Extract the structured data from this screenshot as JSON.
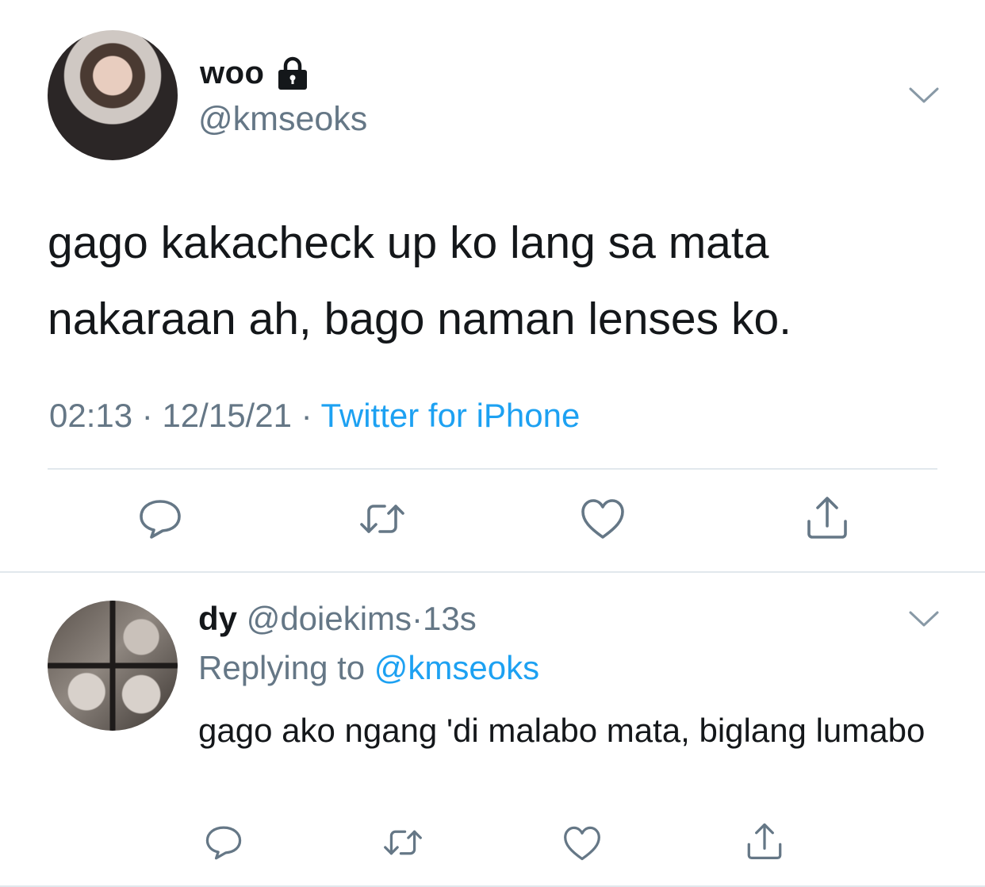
{
  "main_tweet": {
    "display_name": "woo",
    "handle": "@kmseoks",
    "text": "gago kakacheck up ko lang sa mata nakaraan ah, bago naman lenses ko.",
    "time": "02:13",
    "sep1": "·",
    "date": "12/15/21",
    "sep2": "·",
    "source": "Twitter for iPhone",
    "icons": {
      "lock": "lock-icon",
      "menu": "chevron-down-icon",
      "reply": "reply-icon",
      "retweet": "retweet-icon",
      "like": "heart-icon",
      "share": "share-icon"
    }
  },
  "reply_tweet": {
    "display_name": "dy",
    "handle": "@doiekims",
    "sep": "·",
    "age": "13s",
    "replying_prefix": "Replying to",
    "replying_handle": "@kmseoks",
    "text": "gago ako ngang 'di malabo mata, biglang lumabo"
  },
  "colors": {
    "text": "#14171a",
    "secondary": "#657786",
    "link": "#1da1f2",
    "divider": "#e1e8ed",
    "icon": "#657786"
  }
}
